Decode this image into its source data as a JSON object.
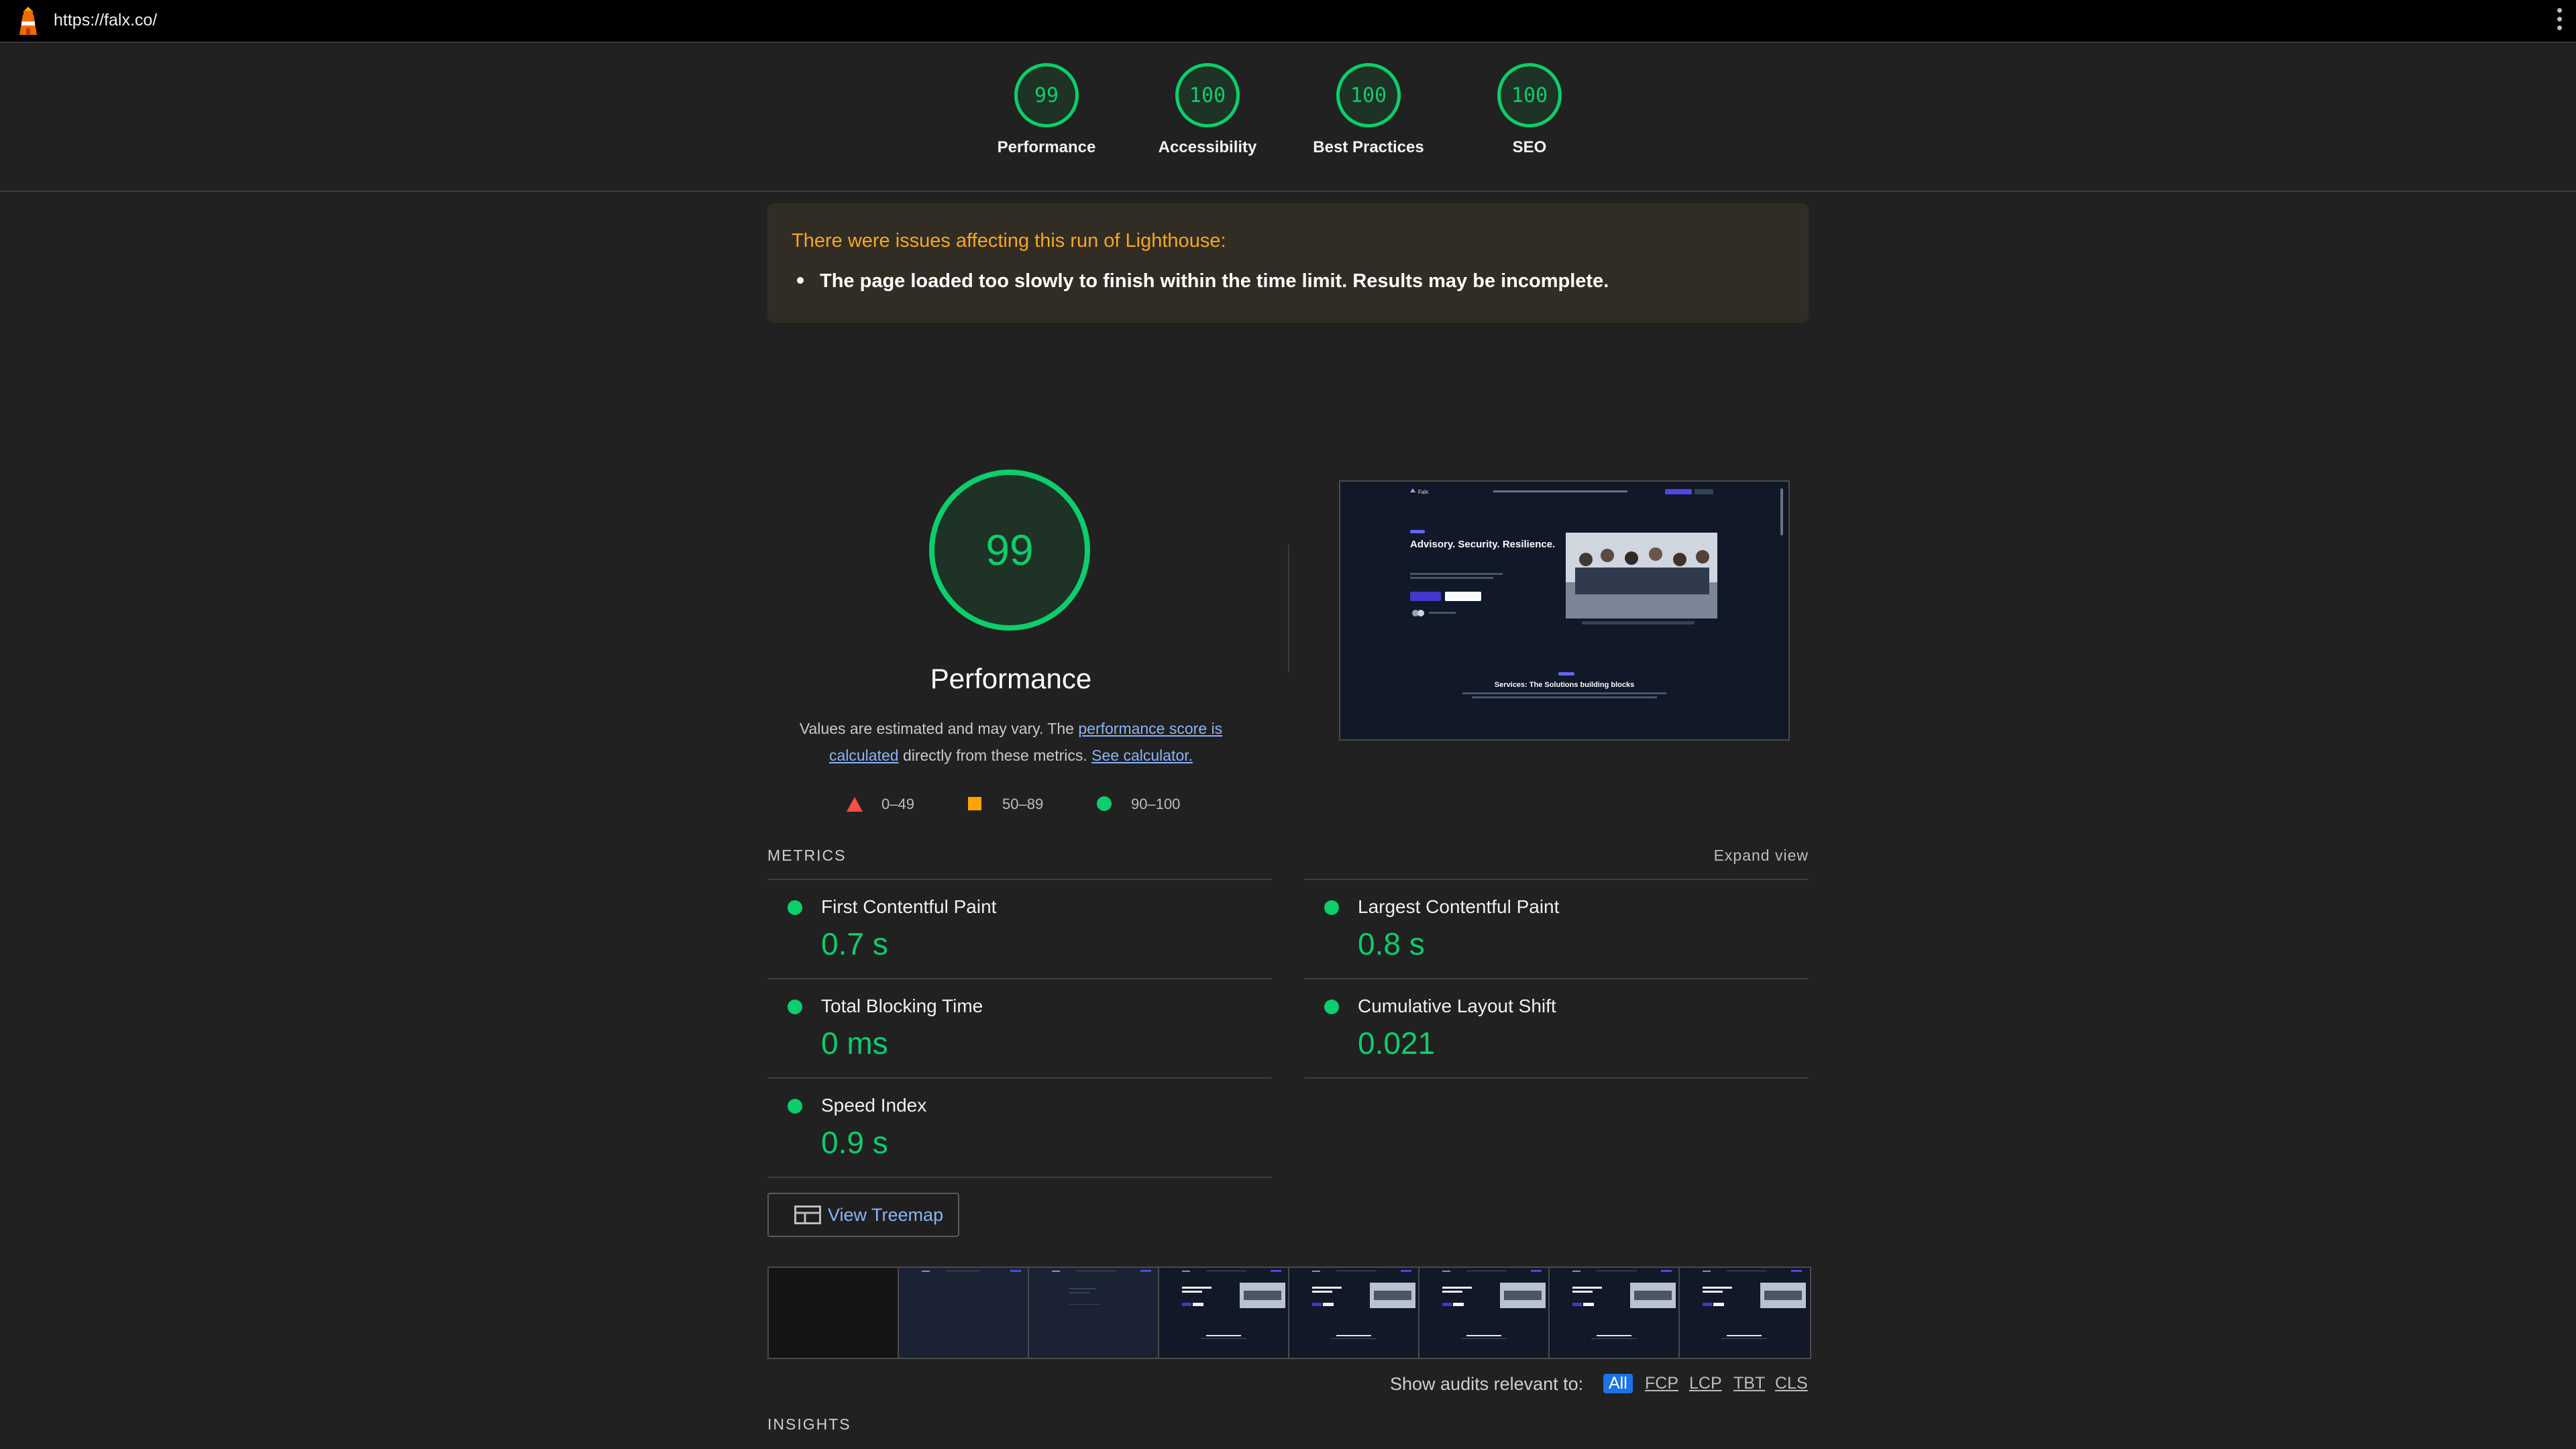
{
  "browser": {
    "url": "https://falx.co/"
  },
  "summary": {
    "gauges": [
      {
        "label": "Performance",
        "score": "99"
      },
      {
        "label": "Accessibility",
        "score": "100"
      },
      {
        "label": "Best Practices",
        "score": "100"
      },
      {
        "label": "SEO",
        "score": "100"
      }
    ]
  },
  "warning": {
    "title": "There were issues affecting this run of Lighthouse:",
    "items": [
      "The page loaded too slowly to finish within the time limit. Results may be incomplete."
    ]
  },
  "performance": {
    "score": "99",
    "title": "Performance",
    "desc_prefix": "Values are estimated and may vary. The ",
    "link1": "performance score is calculated",
    "desc_middle": " directly from these metrics. ",
    "link2": "See calculator.",
    "legend": [
      {
        "icon": "fail-triangle-icon",
        "range": "0–49"
      },
      {
        "icon": "average-square-icon",
        "range": "50–89"
      },
      {
        "icon": "pass-circle-icon",
        "range": "90–100"
      }
    ]
  },
  "screenshot": {
    "headline": "Advisory. Security. Resilience.",
    "section": "Services: The Solutions building blocks",
    "brand": "Falx"
  },
  "metrics": {
    "label": "METRICS",
    "expand": "Expand view",
    "items": [
      {
        "name": "First Contentful Paint",
        "value": "0.7 s"
      },
      {
        "name": "Largest Contentful Paint",
        "value": "0.8 s"
      },
      {
        "name": "Total Blocking Time",
        "value": "0 ms"
      },
      {
        "name": "Cumulative Layout Shift",
        "value": "0.021"
      },
      {
        "name": "Speed Index",
        "value": "0.9 s"
      }
    ]
  },
  "treemap": {
    "label": "View Treemap"
  },
  "audits_filter": {
    "label": "Show audits relevant to:",
    "options": [
      "All",
      "FCP",
      "LCP",
      "TBT",
      "CLS"
    ],
    "active": "All"
  },
  "insights": {
    "label": "INSIGHTS"
  },
  "colors": {
    "pass": "#0cce6b",
    "average": "#ffa400",
    "fail": "#ff4e42",
    "link": "#8ab4f8",
    "warning": "#f5a623"
  }
}
